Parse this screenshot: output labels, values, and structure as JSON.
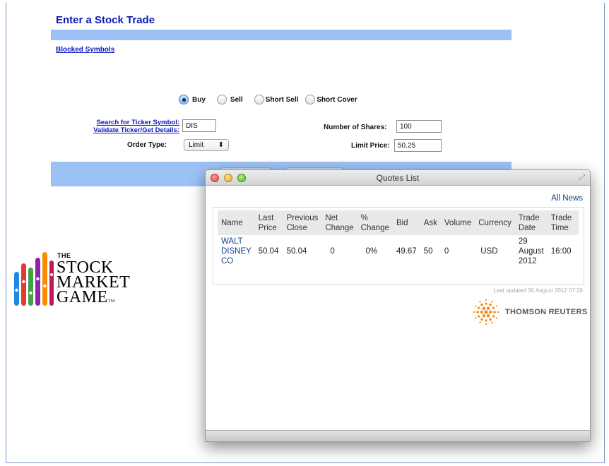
{
  "trade_form": {
    "title": "Enter a Stock Trade",
    "blocked_symbols_link": "Blocked Symbols",
    "actions": [
      {
        "label": "Buy",
        "selected": true
      },
      {
        "label": "Sell",
        "selected": false
      },
      {
        "label": "Short Sell",
        "selected": false
      },
      {
        "label": "Short Cover",
        "selected": false
      }
    ],
    "search_ticker_link": "Search for Ticker Symbol:",
    "validate_ticker_link": "Validate Ticker/Get Details:",
    "ticker_value": "DIS",
    "order_type_label": "Order Type:",
    "order_type_value": "Limit",
    "shares_label": "Number of Shares:",
    "shares_value": "100",
    "limit_price_label": "Limit Price:",
    "limit_price_value": "50.25",
    "accent_color": "#0b1ab8",
    "band_color": "#9cc2f5"
  },
  "logo": {
    "the": "THE",
    "line1": "STOCK",
    "line2": "MARKET",
    "line3": "GAME",
    "tm": "TM"
  },
  "quotes_window": {
    "title": "Quotes List",
    "all_news_link": "All News",
    "columns": [
      "Name",
      "Last Price",
      "Previous Close",
      "Net Change",
      "% Change",
      "Bid",
      "Ask",
      "Volume",
      "Currency",
      "Trade Date",
      "Trade Time"
    ],
    "rows": [
      {
        "name": "WALT DISNEY CO",
        "last_price": "50.04",
        "previous_close": "50.04",
        "net_change": "0",
        "pct_change": "0%",
        "bid": "49.67",
        "ask": "50",
        "volume": "0",
        "currency": "USD",
        "trade_date": "29 August 2012",
        "trade_time": "16:00"
      }
    ],
    "last_updated": "Last updated 30 August 2012 07:26",
    "provider": "THOMSON REUTERS"
  }
}
